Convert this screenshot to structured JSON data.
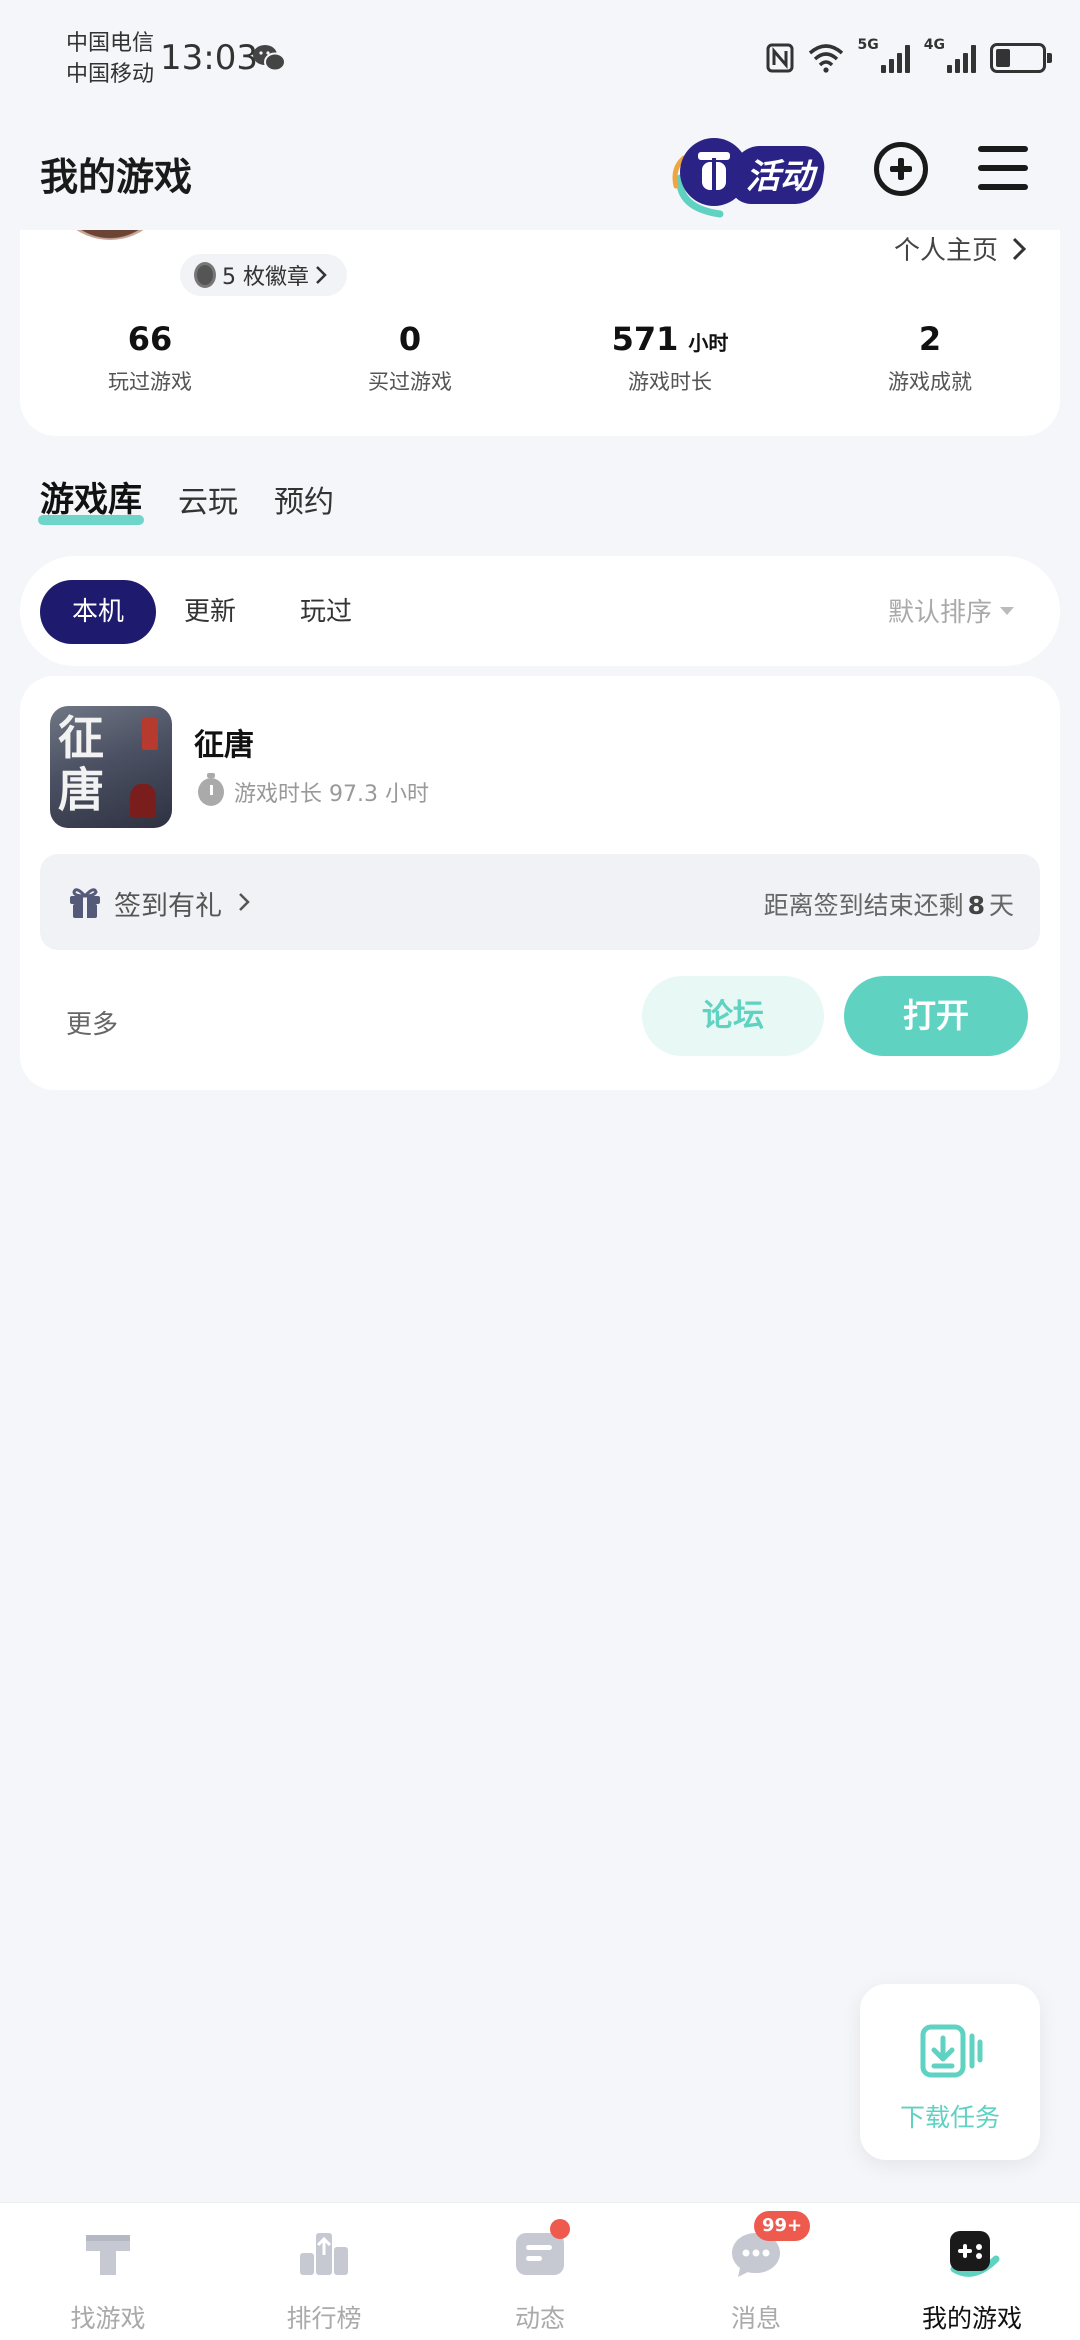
{
  "status_bar": {
    "carrier_1": "中国电信",
    "carrier_2": "中国移动",
    "time": "13:03",
    "signal_1": "5G",
    "signal_2": "4G",
    "battery_level": 0.4
  },
  "header": {
    "title": "我的游戏",
    "activity_label": "活动"
  },
  "profile": {
    "badges": "5 枚徽章",
    "homepage": "个人主页",
    "stats": [
      {
        "value": "66",
        "unit": "",
        "label": "玩过游戏"
      },
      {
        "value": "0",
        "unit": "",
        "label": "买过游戏"
      },
      {
        "value": "571",
        "unit": "小时",
        "label": "游戏时长"
      },
      {
        "value": "2",
        "unit": "",
        "label": "游戏成就"
      }
    ]
  },
  "library_tabs": [
    "游戏库",
    "云玩",
    "预约"
  ],
  "filters": {
    "chips": [
      "本机",
      "更新",
      "玩过"
    ],
    "sort": "默认排序"
  },
  "game": {
    "name": "征唐",
    "icon_glyph": "征唐",
    "playtime": "游戏时长 97.3 小时",
    "checkin_label": "签到有礼",
    "countdown_prefix": "距离签到结束还剩",
    "countdown_days": "8",
    "countdown_suffix": "天",
    "more": "更多",
    "forum": "论坛",
    "open": "打开"
  },
  "download_task": "下载任务",
  "colors": {
    "accent": "#5fd2c2",
    "chip_active": "#1e1a6e",
    "badge_red": "#ef5a4e"
  },
  "bottom_nav": [
    {
      "label": "找游戏",
      "icon": "find-game-icon"
    },
    {
      "label": "排行榜",
      "icon": "ranking-icon"
    },
    {
      "label": "动态",
      "icon": "feed-icon"
    },
    {
      "label": "消息",
      "icon": "message-icon",
      "badge": "99+"
    },
    {
      "label": "我的游戏",
      "icon": "my-games-icon"
    }
  ]
}
